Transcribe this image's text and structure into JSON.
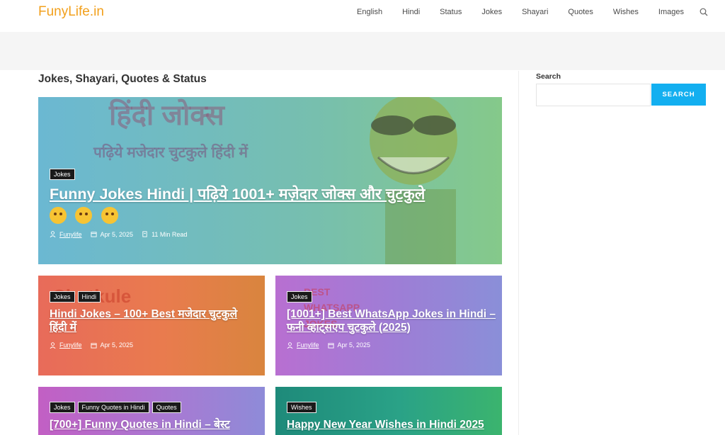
{
  "site": {
    "logo": "FunyLife.in"
  },
  "nav": {
    "items": [
      "English",
      "Hindi",
      "Status",
      "Jokes",
      "Shayari",
      "Quotes",
      "Wishes",
      "Images"
    ]
  },
  "page": {
    "title": "Jokes, Shayari, Quotes & Status"
  },
  "sidebar": {
    "search_title": "Search",
    "search_button": "SEARCH",
    "search_placeholder": ""
  },
  "hero": {
    "deco_title": "हिंदी जोक्स",
    "deco_subtitle": "पढ़िये मजेदार चुटकुले हिंदी में",
    "tags": [
      "Jokes"
    ],
    "title": "Funny Jokes Hindi | पढ़िये 1001+ मज़ेदार जोक्स और चुटकुले",
    "author": "Funylife",
    "date": "Apr 5, 2025",
    "read_time": "11 Min Read",
    "colors": {
      "from": "#6ab6cf",
      "to": "#7fc793"
    }
  },
  "cards": [
    {
      "tags": [
        "Jokes",
        "Hindi"
      ],
      "title": "Hindi Jokes – 100+ Best मजेदार चुटकुले हिंदी में",
      "author": "Funylife",
      "date": "Apr 5, 2025",
      "deco": "Chutkule"
    },
    {
      "tags": [
        "Jokes"
      ],
      "title": "[1001+] Best WhatsApp Jokes in Hindi – फनी व्हाट्सएप चुटकुले (2025)",
      "author": "Funylife",
      "date": "Apr 5, 2025",
      "deco": "BEST WHATSAPP JOKES"
    },
    {
      "tags": [
        "Jokes",
        "Funny Quotes in Hindi",
        "Quotes"
      ],
      "title": "[700+] Funny Quotes in Hindi – बेस्ट"
    },
    {
      "tags": [
        "Wishes"
      ],
      "title": "Happy New Year Wishes in Hindi 2025"
    }
  ]
}
